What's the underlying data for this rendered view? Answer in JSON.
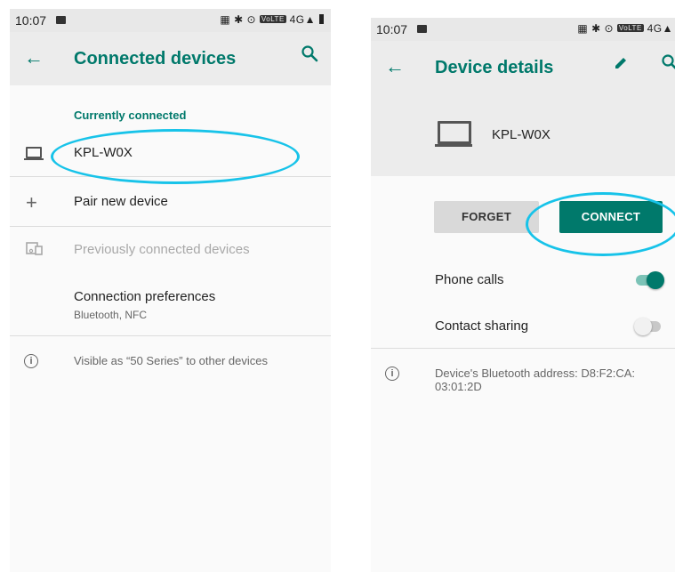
{
  "left_screen": {
    "status_bar": {
      "time": "10:07"
    },
    "app_bar": {
      "title": "Connected devices"
    },
    "section_header": "Currently connected",
    "connected_device": {
      "name": "KPL-W0X"
    },
    "pair_new": {
      "label": "Pair new device"
    },
    "previously_connected": {
      "label": "Previously connected devices"
    },
    "connection_preferences": {
      "label": "Connection preferences",
      "summary": "Bluetooth, NFC"
    },
    "visibility_info": "Visible as “50 Series” to other devices"
  },
  "right_screen": {
    "status_bar": {
      "time": "10:07"
    },
    "app_bar": {
      "title": "Device details"
    },
    "device": {
      "name": "KPL-W0X"
    },
    "buttons": {
      "forget": "FORGET",
      "connect": "CONNECT"
    },
    "profiles": [
      {
        "label": "Phone calls",
        "enabled": true
      },
      {
        "label": "Contact sharing",
        "enabled": false
      }
    ],
    "address_info": "Device's Bluetooth address: D8:F2:CA:\n03:01:2D"
  },
  "colors": {
    "accent": "#00796b",
    "highlight": "#17c3e9"
  },
  "icons": [
    "back-arrow-icon",
    "search-icon",
    "edit-pencil-icon",
    "laptop-icon",
    "plus-icon",
    "devices-icon",
    "info-icon"
  ]
}
